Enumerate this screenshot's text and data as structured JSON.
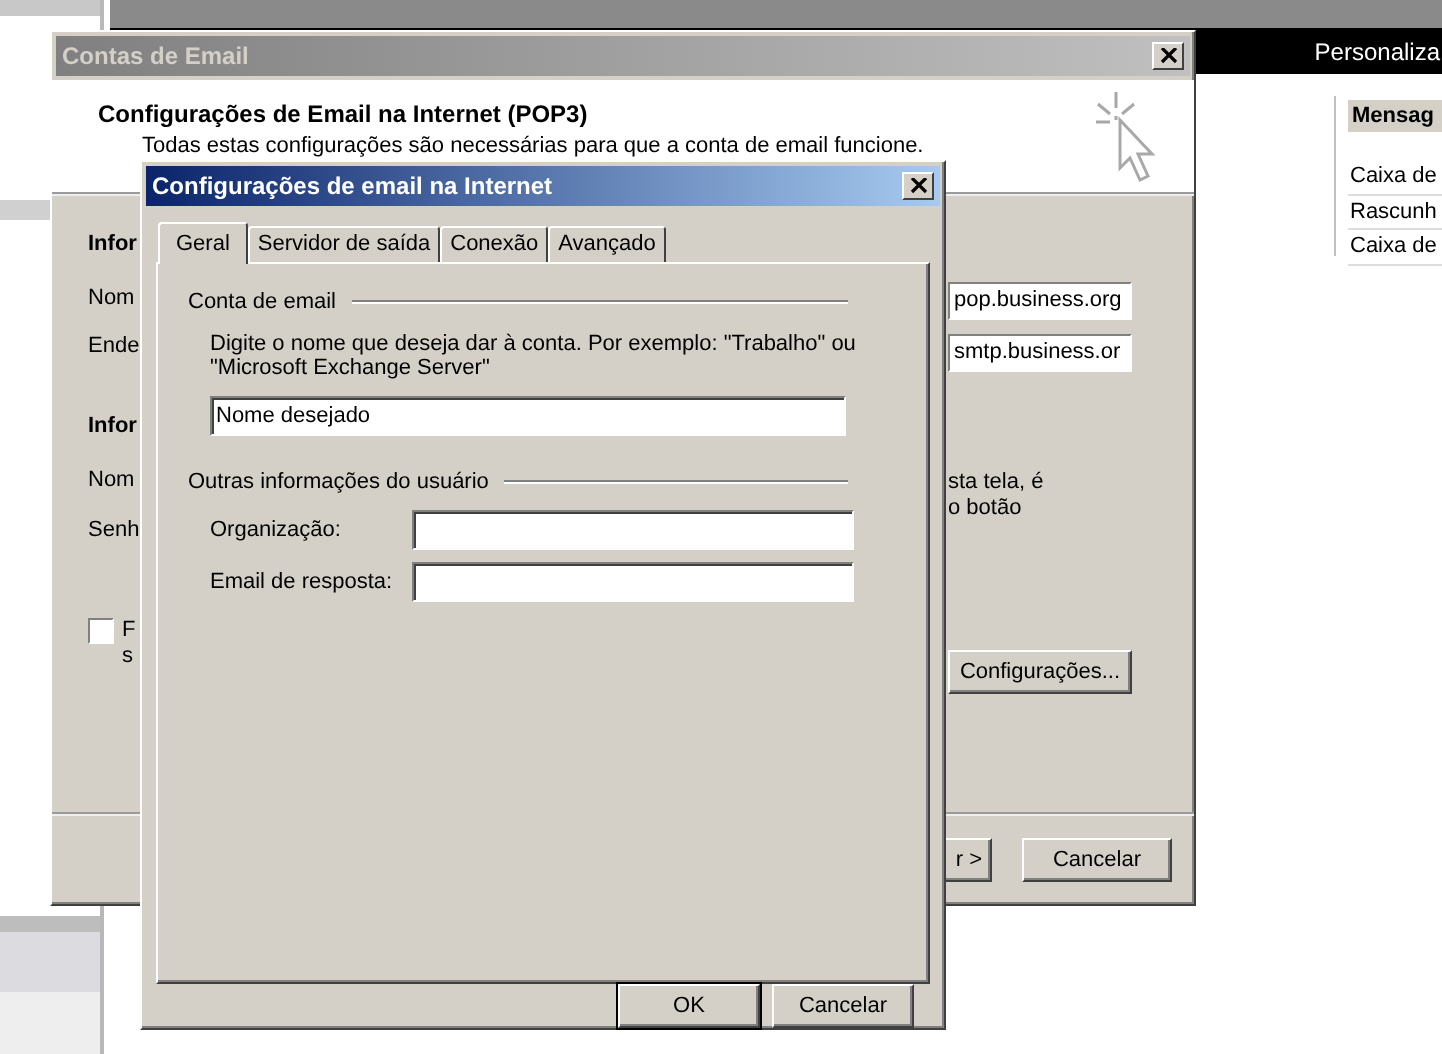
{
  "background_app": {
    "toolbar_label": "Personaliza",
    "right_pane": {
      "header": "Mensag",
      "items": [
        "Caixa de",
        "Rascunh",
        "Caixa de"
      ]
    }
  },
  "account_dialog": {
    "title": "Contas de Email",
    "heading": "Configurações de Email na Internet (POP3)",
    "subtitle": "Todas estas configurações são necessárias para que a conta de email funcione.",
    "left_labels": [
      {
        "text": "Infor",
        "kind": "section"
      },
      {
        "text": "Nom",
        "kind": "label"
      },
      {
        "text": "Ende",
        "kind": "label"
      },
      {
        "text": "Infor",
        "kind": "section"
      },
      {
        "text": "Nom",
        "kind": "label"
      },
      {
        "text": "Senh",
        "kind": "label"
      }
    ],
    "checkbox": {
      "label_lines": [
        "F",
        "s"
      ],
      "checked": false
    },
    "incoming_server": "pop.business.org",
    "outgoing_server": "smtp.business.or",
    "note_lines": [
      "sta tela, é",
      "o botão"
    ],
    "more_settings_button": "Configurações...",
    "buttons": [
      "r >",
      "Cancelar"
    ]
  },
  "settings_dialog": {
    "title": "Configurações de email na Internet",
    "tabs": [
      {
        "label": "Geral",
        "selected": true
      },
      {
        "label": "Servidor de saída",
        "selected": false
      },
      {
        "label": "Conexão",
        "selected": false
      },
      {
        "label": "Avançado",
        "selected": false
      }
    ],
    "account_section": {
      "title": "Conta de email",
      "description": "Digite o nome que deseja dar à conta. Por exemplo: \"Trabalho\" ou \"Microsoft Exchange Server\"",
      "value": "Nome desejado"
    },
    "user_section": {
      "title": "Outras informações do usuário",
      "fields": [
        {
          "label": "Organização:"
        },
        {
          "label": "Email de resposta:"
        }
      ]
    },
    "buttons": [
      "OK",
      "Cancelar"
    ]
  }
}
